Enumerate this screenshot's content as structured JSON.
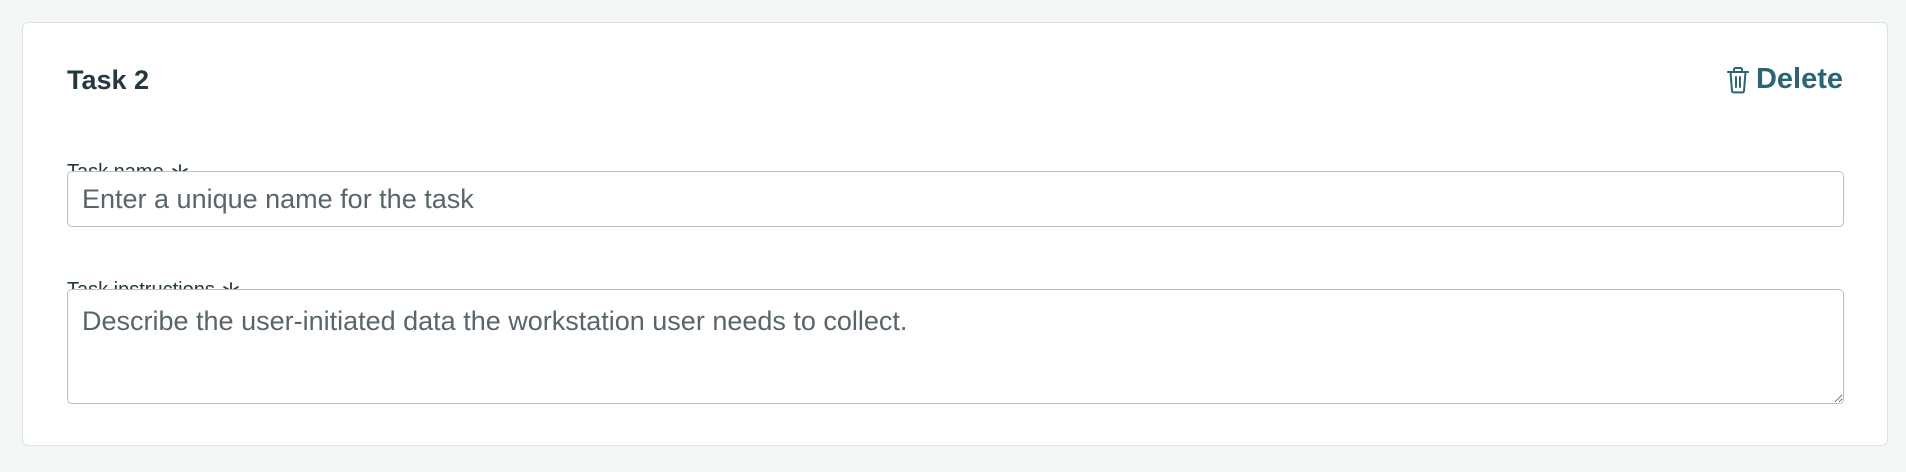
{
  "task": {
    "title": "Task 2",
    "delete_label": "Delete",
    "delete_icon": "trash-icon",
    "required_icon": "asterisk-icon"
  },
  "fields": {
    "name": {
      "label": "Task name",
      "placeholder": "Enter a unique name for the task",
      "value": ""
    },
    "instructions": {
      "label": "Task instructions",
      "placeholder": "Describe the user-initiated data the workstation user needs to collect.",
      "value": ""
    }
  },
  "colors": {
    "accent": "#2a6475",
    "text": "#253840",
    "border": "#b7c1c5",
    "background": "#f4f7f7"
  }
}
